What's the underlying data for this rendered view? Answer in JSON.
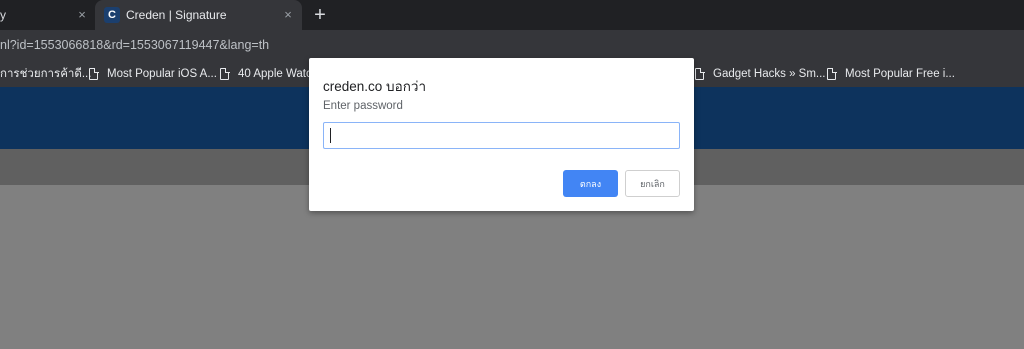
{
  "tabs": [
    {
      "label": "y",
      "close": "×"
    },
    {
      "label": "Creden | Signature",
      "favicon": "C",
      "close": "×",
      "active": true
    }
  ],
  "new_tab": "+",
  "address_bar": {
    "url": "nl?id=1553066818&rd=1553067119447&lang=th"
  },
  "bookmarks": [
    {
      "label": "การช่วยการค้าดี...",
      "icon": "none"
    },
    {
      "label": "Most Popular iOS A...",
      "icon": "doc-icon"
    },
    {
      "label": "40 Apple Watch",
      "icon": "doc-icon"
    },
    {
      "label": "Gadget Hacks » Sm...",
      "icon": "doc-icon"
    },
    {
      "label": "Most Popular Free i...",
      "icon": "doc-icon"
    }
  ],
  "dialog": {
    "title": "creden.co บอกว่า",
    "message": "Enter password",
    "input_value": "",
    "ok_label": "ตกลง",
    "cancel_label": "ยกเลิก"
  },
  "colors": {
    "tabbar": "#202124",
    "toolbar": "#35363a",
    "header": "#0d335d",
    "accent_button": "#4285f4",
    "overlay": "#808080"
  }
}
